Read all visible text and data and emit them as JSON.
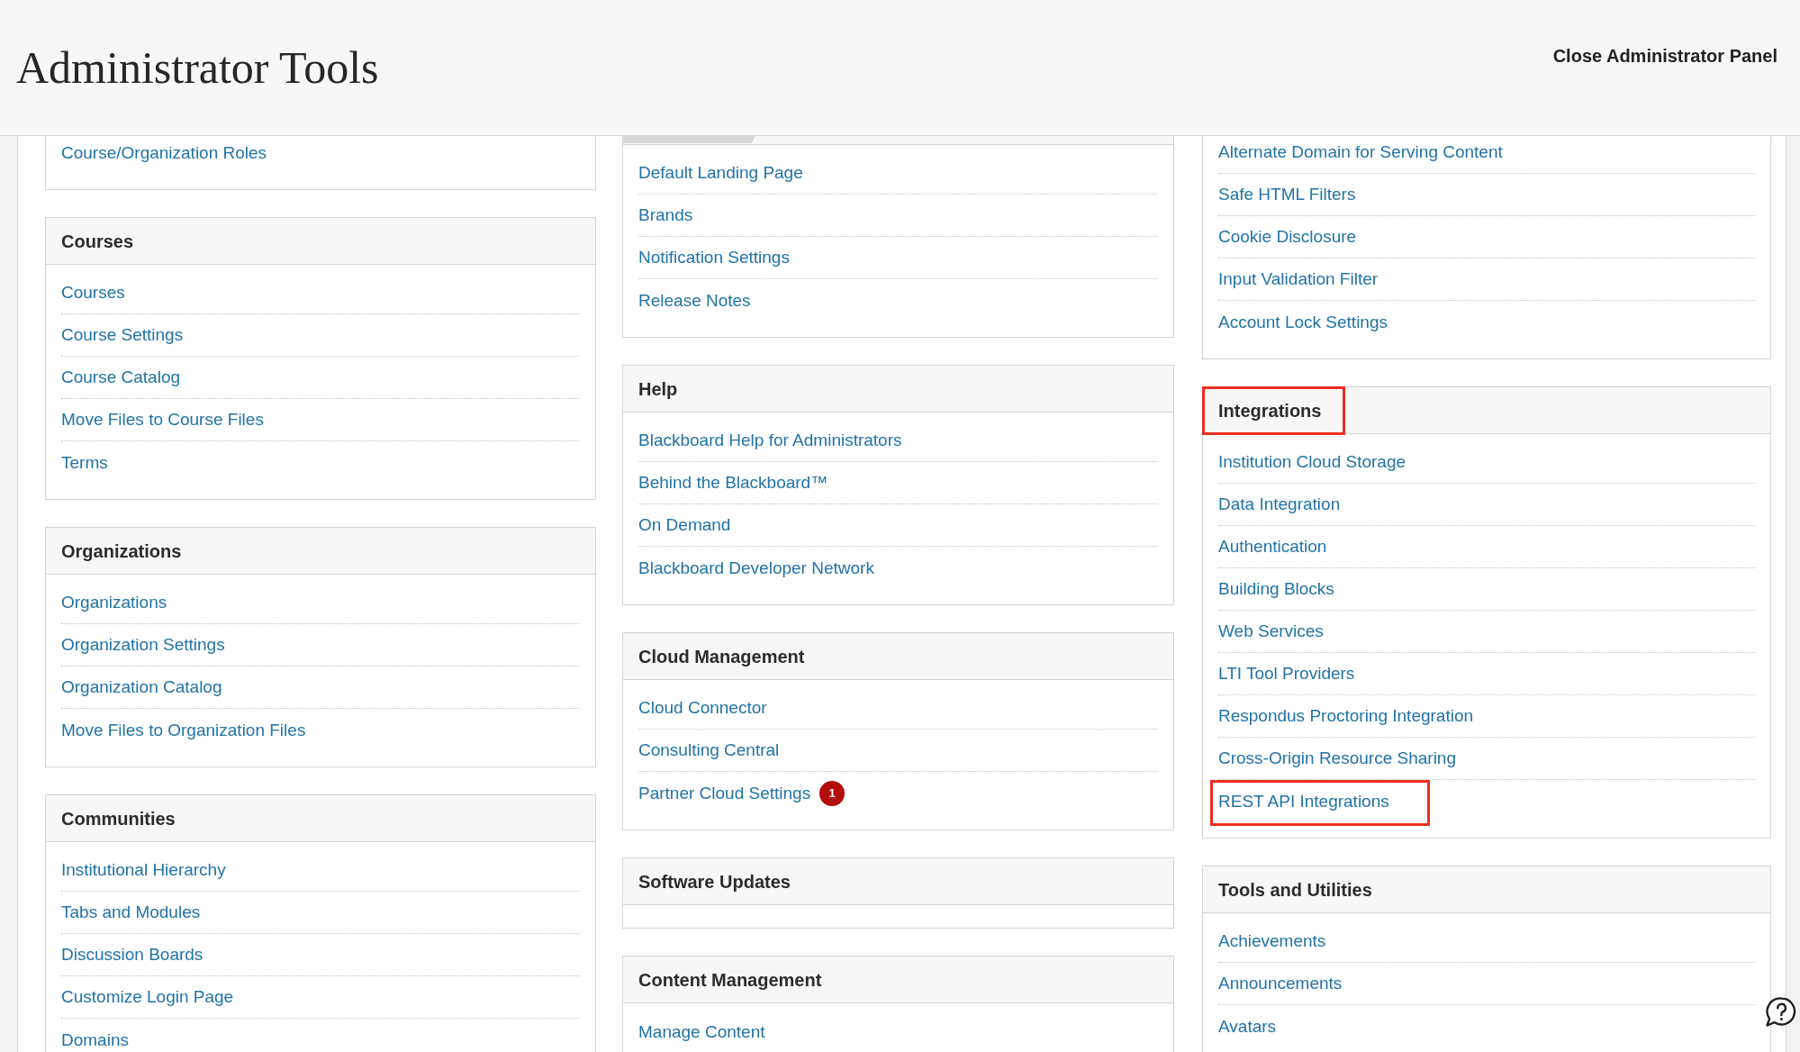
{
  "header": {
    "title": "Administrator Tools",
    "close_link": "Close Administrator Panel"
  },
  "columns": [
    {
      "sections": [
        {
          "kind": "cut",
          "highlighted": false,
          "items": [
            {
              "label": "Course/Organization Roles",
              "highlighted": false
            }
          ]
        },
        {
          "kind": "full",
          "title": "Courses",
          "highlighted": false,
          "items": [
            {
              "label": "Courses",
              "highlighted": false
            },
            {
              "label": "Course Settings",
              "highlighted": false
            },
            {
              "label": "Course Catalog",
              "highlighted": false
            },
            {
              "label": "Move Files to Course Files",
              "highlighted": false
            },
            {
              "label": "Terms",
              "highlighted": false
            }
          ]
        },
        {
          "kind": "full",
          "title": "Organizations",
          "highlighted": false,
          "items": [
            {
              "label": "Organizations",
              "highlighted": false
            },
            {
              "label": "Organization Settings",
              "highlighted": false
            },
            {
              "label": "Organization Catalog",
              "highlighted": false
            },
            {
              "label": "Move Files to Organization Files",
              "highlighted": false
            }
          ]
        },
        {
          "kind": "full",
          "title": "Communities",
          "highlighted": false,
          "items": [
            {
              "label": "Institutional Hierarchy",
              "highlighted": false
            },
            {
              "label": "Tabs and Modules",
              "highlighted": false
            },
            {
              "label": "Discussion Boards",
              "highlighted": false
            },
            {
              "label": "Customize Login Page",
              "highlighted": false
            },
            {
              "label": "Domains",
              "highlighted": false
            }
          ]
        }
      ]
    },
    {
      "sections": [
        {
          "kind": "cut_header",
          "highlighted": false,
          "items": [
            {
              "label": "Default Landing Page",
              "highlighted": false
            },
            {
              "label": "Brands",
              "highlighted": false
            },
            {
              "label": "Notification Settings",
              "highlighted": false
            },
            {
              "label": "Release Notes",
              "highlighted": false
            }
          ]
        },
        {
          "kind": "full",
          "title": "Help",
          "highlighted": false,
          "items": [
            {
              "label": "Blackboard Help for Administrators",
              "highlighted": false
            },
            {
              "label": "Behind the Blackboard™",
              "highlighted": false
            },
            {
              "label": "On Demand",
              "highlighted": false
            },
            {
              "label": "Blackboard Developer Network",
              "highlighted": false
            }
          ]
        },
        {
          "kind": "full",
          "title": "Cloud Management",
          "highlighted": false,
          "items": [
            {
              "label": "Cloud Connector",
              "highlighted": false
            },
            {
              "label": "Consulting Central",
              "highlighted": false
            },
            {
              "label": "Partner Cloud Settings",
              "highlighted": false,
              "badge": "1"
            }
          ]
        },
        {
          "kind": "full",
          "title": "Software Updates",
          "highlighted": false
        },
        {
          "kind": "full",
          "title": "Content Management",
          "highlighted": false,
          "items": [
            {
              "label": "Manage Content",
              "highlighted": false
            }
          ]
        }
      ]
    },
    {
      "sections": [
        {
          "kind": "cut",
          "highlighted": false,
          "items": [
            {
              "label": "Alternate Domain for Serving Content",
              "highlighted": false
            },
            {
              "label": "Safe HTML Filters",
              "highlighted": false
            },
            {
              "label": "Cookie Disclosure",
              "highlighted": false
            },
            {
              "label": "Input Validation Filter",
              "highlighted": false
            },
            {
              "label": "Account Lock Settings",
              "highlighted": false
            }
          ]
        },
        {
          "kind": "full",
          "title": "Integrations",
          "highlighted": true,
          "items": [
            {
              "label": "Institution Cloud Storage",
              "highlighted": false
            },
            {
              "label": "Data Integration",
              "highlighted": false
            },
            {
              "label": "Authentication",
              "highlighted": false
            },
            {
              "label": "Building Blocks",
              "highlighted": false
            },
            {
              "label": "Web Services",
              "highlighted": false
            },
            {
              "label": "LTI Tool Providers",
              "highlighted": false
            },
            {
              "label": "Respondus Proctoring Integration",
              "highlighted": false
            },
            {
              "label": "Cross-Origin Resource Sharing",
              "highlighted": false
            },
            {
              "label": "REST API Integrations",
              "highlighted": true
            }
          ]
        },
        {
          "kind": "full",
          "title": "Tools and Utilities",
          "highlighted": false,
          "items": [
            {
              "label": "Achievements",
              "highlighted": false
            },
            {
              "label": "Announcements",
              "highlighted": false
            },
            {
              "label": "Avatars",
              "highlighted": false
            }
          ]
        }
      ]
    }
  ]
}
